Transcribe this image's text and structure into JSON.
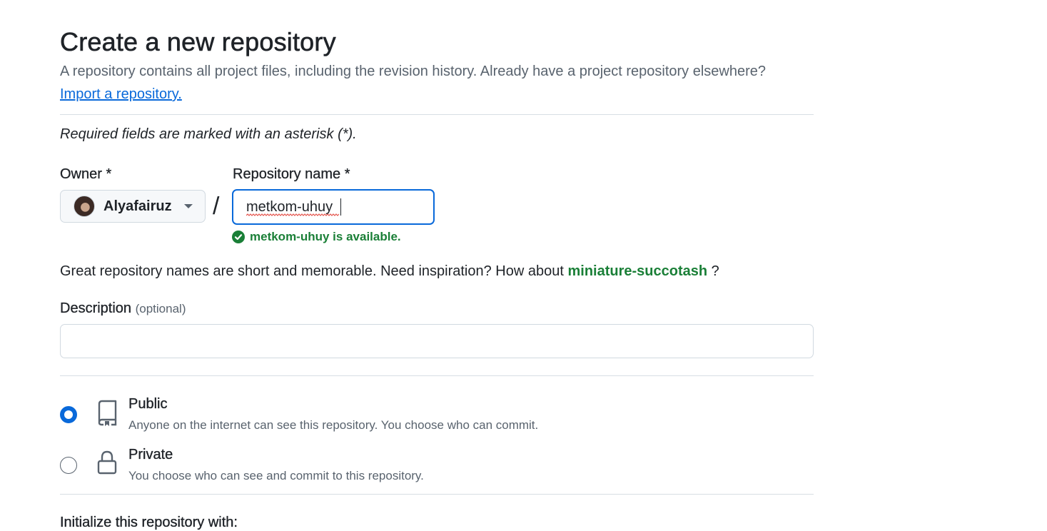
{
  "header": {
    "title": "Create a new repository",
    "subtitle": "A repository contains all project files, including the revision history. Already have a project repository elsewhere?",
    "import_link": "Import a repository."
  },
  "form": {
    "required_note": "Required fields are marked with an asterisk (*).",
    "owner": {
      "label": "Owner *",
      "selected": "Alyafairuz",
      "avatar_icon": "user-avatar"
    },
    "separator": "/",
    "repo_name": {
      "label": "Repository name *",
      "value": "metkom-uhuy",
      "availability": "metkom-uhuy is available.",
      "availability_icon": "check-circle-icon"
    },
    "inspiration": {
      "text": "Great repository names are short and memorable. Need inspiration? How about",
      "suggestion": "miniature-succotash",
      "suffix": "?"
    },
    "description": {
      "label": "Description",
      "optional": "(optional)",
      "value": ""
    },
    "visibility": [
      {
        "title": "Public",
        "description": "Anyone on the internet can see this repository. You choose who can commit.",
        "icon": "repo-icon",
        "selected": true
      },
      {
        "title": "Private",
        "description": "You choose who can see and commit to this repository.",
        "icon": "lock-icon",
        "selected": false
      }
    ],
    "initialize_heading": "Initialize this repository with:"
  },
  "colors": {
    "accent": "#0969da",
    "success": "#1a7f37",
    "muted_text": "#59636e",
    "border": "#d1d9e0"
  }
}
